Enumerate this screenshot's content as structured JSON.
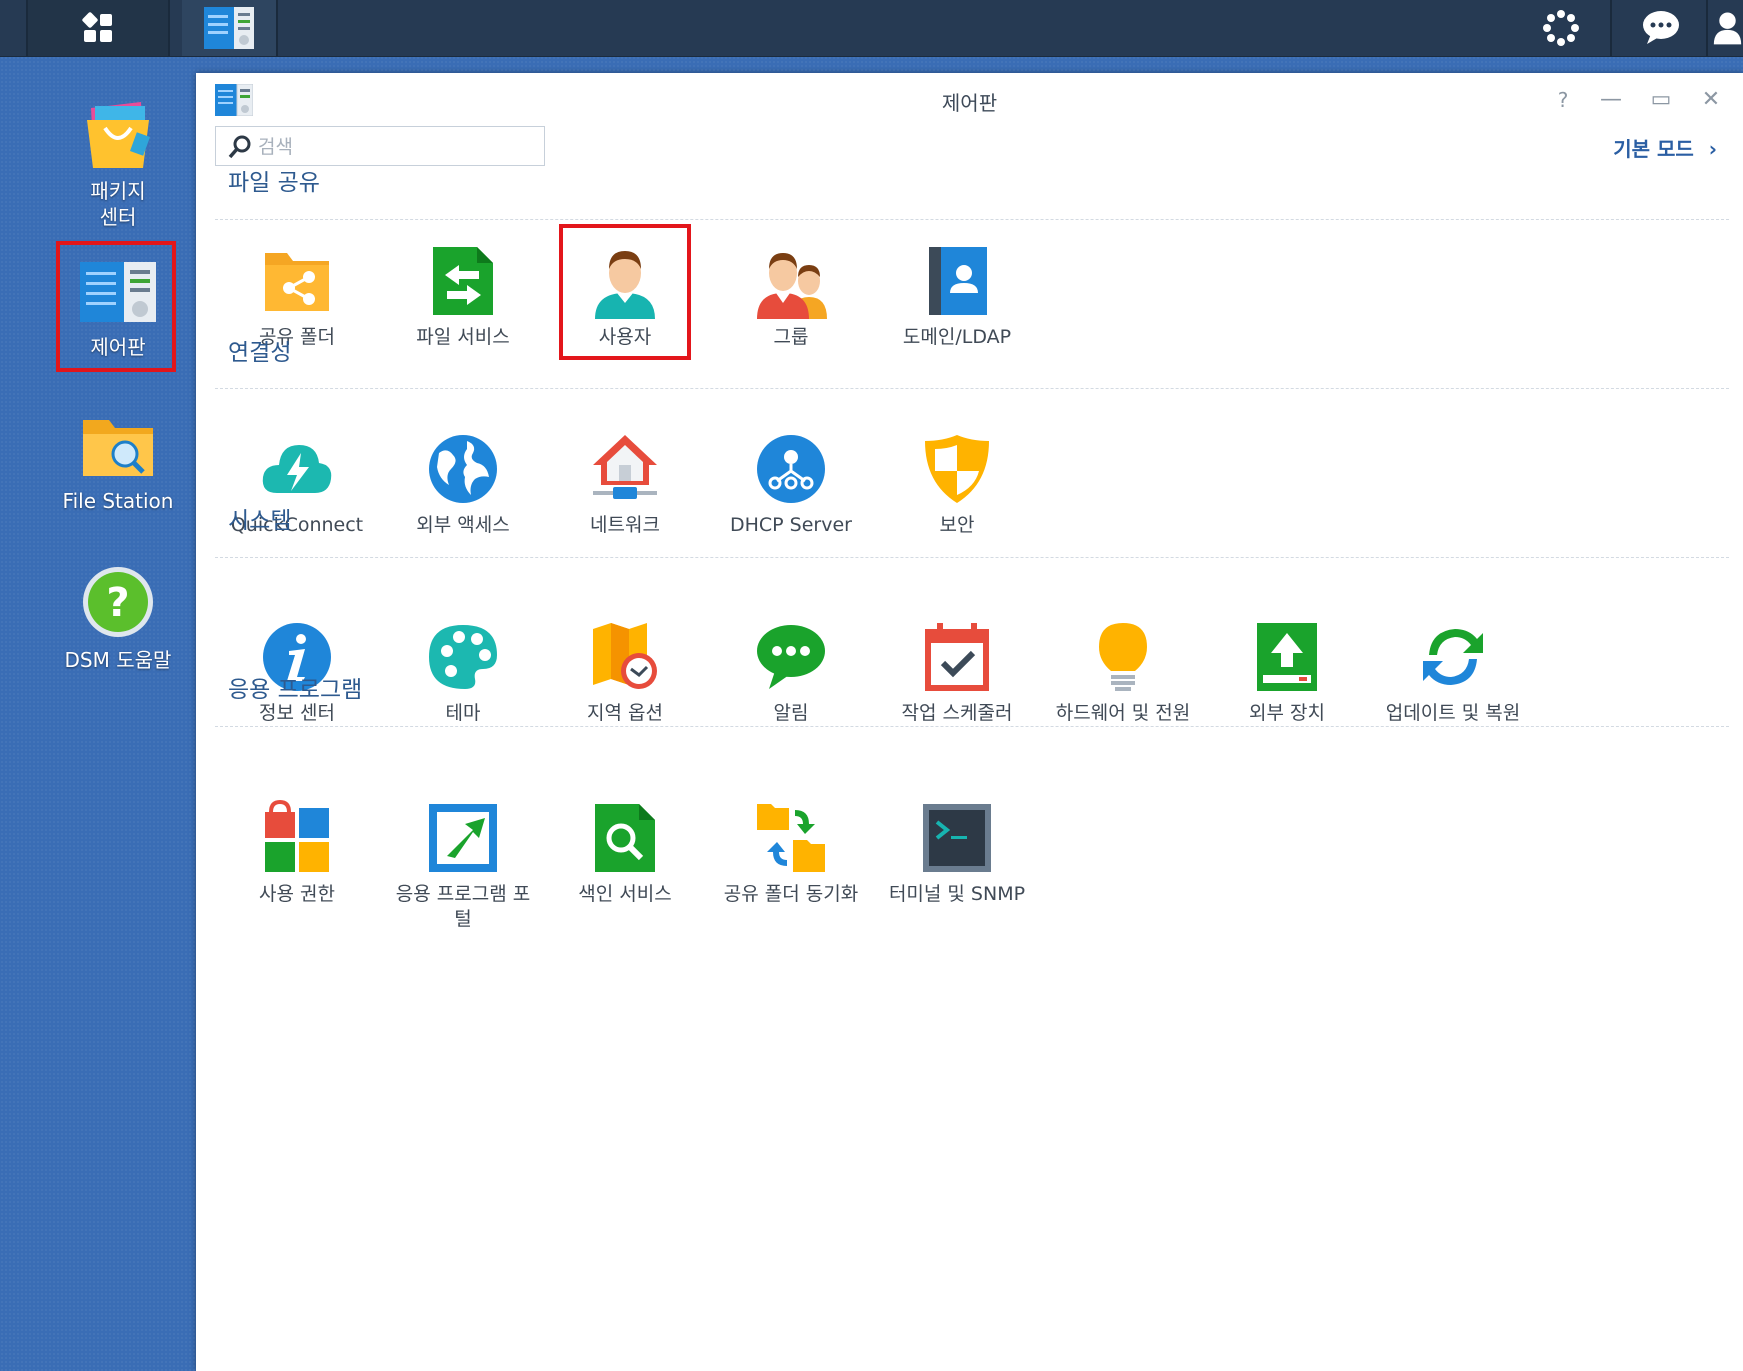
{
  "taskbar": {
    "main_menu_icon": "grid-icon",
    "open_app_icon": "control-panel-icon",
    "right_icons": [
      "widgets-icon",
      "chat-icon",
      "user-icon"
    ]
  },
  "desktop": {
    "items": [
      {
        "label_line1": "패키지",
        "label_line2": "센터",
        "icon": "package-center-icon"
      },
      {
        "label": "제어판",
        "icon": "control-panel-icon"
      },
      {
        "label": "File Station",
        "icon": "file-station-icon"
      },
      {
        "label": "DSM 도움말",
        "icon": "help-icon"
      }
    ]
  },
  "window": {
    "title": "제어판",
    "search_placeholder": "검색",
    "mode_link": "기본 모드",
    "controls": {
      "help": "?",
      "minimize": "—",
      "maximize": "▭",
      "close": "✕"
    },
    "sections": [
      {
        "title": "파일 공유",
        "items": [
          {
            "label": "공유 폴더",
            "icon": "shared-folder-icon"
          },
          {
            "label": "파일 서비스",
            "icon": "file-services-icon"
          },
          {
            "label": "사용자",
            "icon": "user-icon"
          },
          {
            "label": "그룹",
            "icon": "group-icon"
          },
          {
            "label": "도메인/LDAP",
            "icon": "domain-ldap-icon"
          }
        ]
      },
      {
        "title": "연결성",
        "items": [
          {
            "label": "QuickConnect",
            "icon": "quickconnect-icon"
          },
          {
            "label": "외부 액세스",
            "icon": "globe-icon"
          },
          {
            "label": "네트워크",
            "icon": "network-icon"
          },
          {
            "label": "DHCP Server",
            "icon": "dhcp-icon"
          },
          {
            "label": "보안",
            "icon": "shield-icon"
          }
        ]
      },
      {
        "title": "시스템",
        "items": [
          {
            "label": "정보 센터",
            "icon": "info-icon"
          },
          {
            "label": "테마",
            "icon": "palette-icon"
          },
          {
            "label": "지역 옵션",
            "icon": "map-clock-icon"
          },
          {
            "label": "알림",
            "icon": "speech-bubble-icon"
          },
          {
            "label": "작업 스케줄러",
            "icon": "calendar-check-icon"
          },
          {
            "label": "하드웨어 및 전원",
            "icon": "lightbulb-icon"
          },
          {
            "label": "외부 장치",
            "icon": "external-device-icon"
          },
          {
            "label": "업데이트 및 복원",
            "icon": "update-restore-icon"
          }
        ]
      },
      {
        "title": "응용 프로그램",
        "items": [
          {
            "label": "사용 권한",
            "icon": "privileges-icon"
          },
          {
            "label_line1": "응용 프로그램 포",
            "label_line2": "털",
            "icon": "application-portal-icon"
          },
          {
            "label": "색인 서비스",
            "icon": "indexing-service-icon"
          },
          {
            "label": "공유 폴더 동기화",
            "icon": "folder-sync-icon"
          },
          {
            "label": "터미널 및 SNMP",
            "icon": "terminal-icon"
          }
        ]
      }
    ]
  }
}
